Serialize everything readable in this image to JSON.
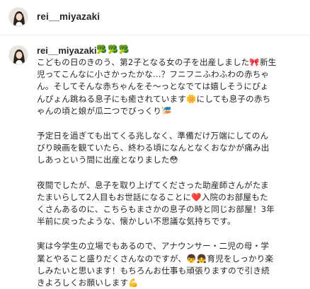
{
  "header": {
    "username": "rei__miyazaki"
  },
  "comment": {
    "username": "rei__miyazaki",
    "trailing_emoji": "🥦🥦🥦",
    "paragraphs": [
      "こどもの日のきのう、第2子となる女の子を出産しました🎀新生\n児ってこんなに小さかったかな…？フニフニふわふわの赤ちゃ\nん。そしてそんな赤ちゃんをそ〜っとなでては嬉しそうにぴょ\nんぴょん跳ねる息子にも癒されています🌼にしても息子の赤ち\nゃんの頃と娘が瓜二つでびっくり🎏",
      "予定日を過ぎても出てくる兆しなく、準備だけ万端にしてのん\nびり映画を観ていたら、終わる頃になんとなくおなかが痛み出\nしあっという間に出産となりました😳",
      "夜間でしたが、息子を取り上げてくださった助産師さんがたま\nたまいらして2人目もお世話になることに❤️入院のお部屋もた\nくさんあるのに、こちらもまさかの息子の時と同じお部屋！3年\n半前に戻ったような、懐かしい不思議な気持ちです。",
      "実は今学生の立場でもあるので、アナウンサー・二児の母・学\n業とやること盛りだくさんなのですが、👦👧育児をしっかり楽\nしみたいと思います！もちろんお仕事も頑張りますので引き続\nきよろしくお願いします💪"
    ]
  }
}
